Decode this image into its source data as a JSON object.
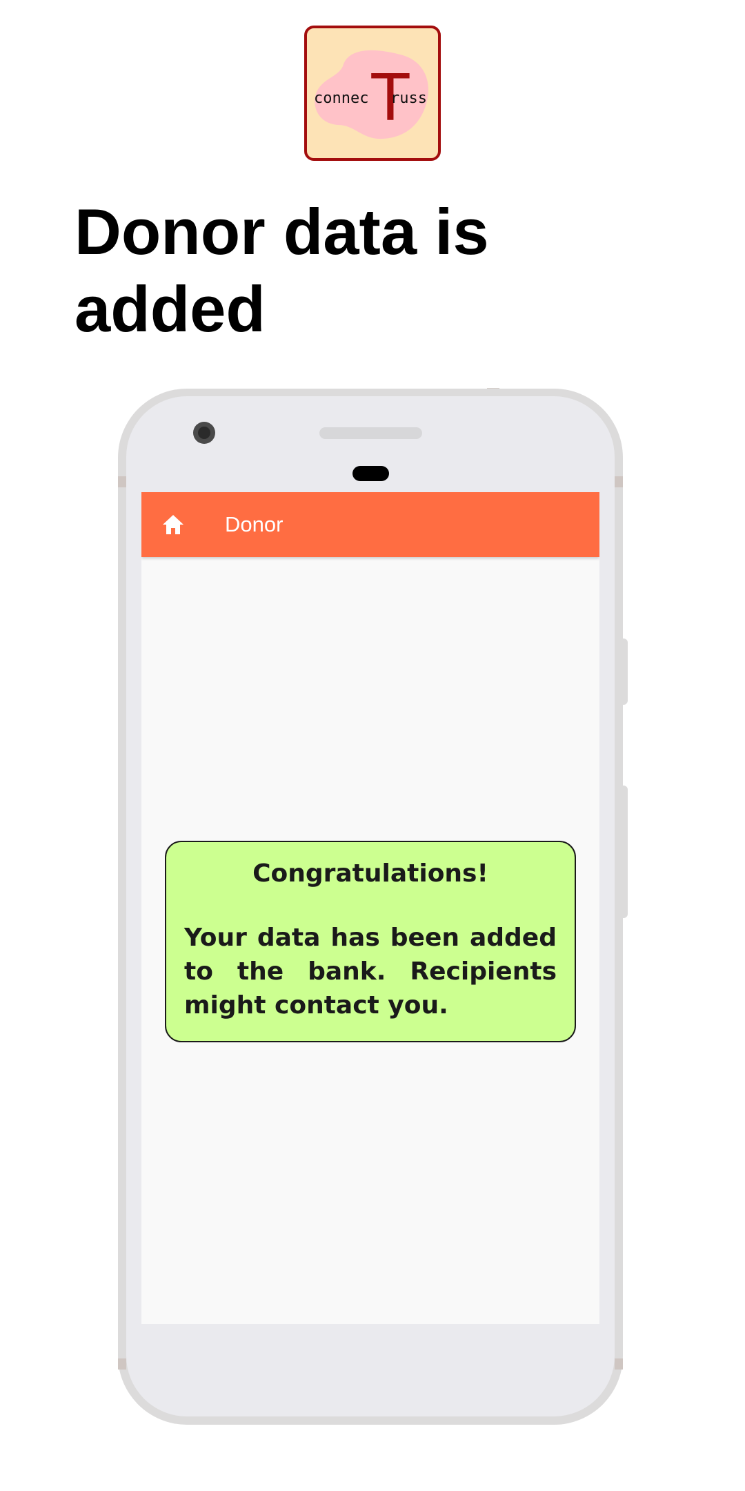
{
  "logo": {
    "text_left": "connec",
    "text_big": "T",
    "text_right": "russ",
    "colors": {
      "background": "#fde3b6",
      "border": "#a30d0d",
      "blob": "#ffc2c8",
      "letter": "#a30d0d",
      "text": "#111111"
    }
  },
  "headline": "Donor data is added",
  "app": {
    "appbar": {
      "icon": "home-icon",
      "title": "Donor",
      "color": "#ff6d42"
    },
    "message": {
      "title": "Congratulations!",
      "body": "Your data has been added to the bank. Recipients might contact you.",
      "background": "#ccff90"
    }
  }
}
